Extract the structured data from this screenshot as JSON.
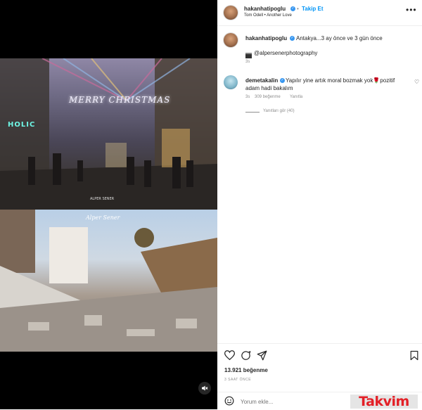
{
  "post": {
    "author": "hakanhatipoglu",
    "follow_label": "Takip Et",
    "audio": "Tom Odell • Another Love",
    "more_glyph": "•••"
  },
  "media": {
    "overlay_text_top": "MERRY CHRISTMAS",
    "shop_sign": "HOLIC",
    "watermark_top": "ALPER SENER",
    "watermark_bottom": "Alper Sener"
  },
  "caption": {
    "author": "hakanhatipoglu",
    "text": "Antakya...3 ay önce ve 3 gün önce",
    "credit": "@alpersenerphotography",
    "time": "3s"
  },
  "comments": [
    {
      "author": "demetakalin",
      "text": "Yapılır yine artık moral bozmak yok🌹pozitif adam hadi bakalım",
      "time": "3s",
      "likes": "309 beğenme",
      "reply_label": "Yanıtla",
      "view_replies": "Yanıtları gör (40)"
    }
  ],
  "footer": {
    "likes": "13.921 beğenme",
    "timestamp": "3 SAAT ÖNCE",
    "comment_placeholder": "Yorum ekle...",
    "watermark": "Takvim"
  },
  "icons": {
    "like": "heart-icon",
    "comment": "comment-icon",
    "share": "share-icon",
    "save": "bookmark-icon",
    "mute": "speaker-muted-icon"
  },
  "colors": {
    "link_blue": "#0095f6",
    "verified_blue": "#3897f0",
    "watermark_red": "#e32027"
  }
}
